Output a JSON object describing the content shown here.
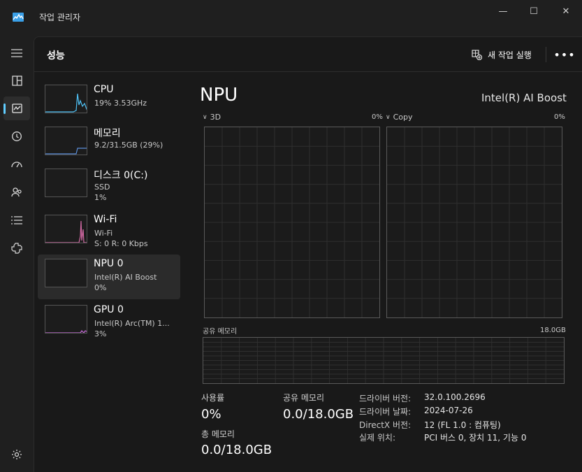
{
  "window": {
    "title": "작업 관리자",
    "controls": {
      "minimize": "—",
      "maximize": "☐",
      "close": "✕"
    }
  },
  "nav": {
    "items": [
      {
        "name": "hamburger-icon"
      },
      {
        "name": "processes-icon"
      },
      {
        "name": "performance-icon",
        "active": true
      },
      {
        "name": "app-history-icon"
      },
      {
        "name": "startup-apps-icon"
      },
      {
        "name": "users-icon"
      },
      {
        "name": "details-icon"
      },
      {
        "name": "services-icon"
      },
      {
        "name": "settings-icon"
      }
    ]
  },
  "header": {
    "title": "성능",
    "run_task": "새 작업 실행",
    "more": "•••"
  },
  "devices": [
    {
      "name": "CPU",
      "sub1": "19% 3.53GHz",
      "sub2": "",
      "color": "#4fc3f7"
    },
    {
      "name": "메모리",
      "sub1": "9.2/31.5GB (29%)",
      "sub2": "",
      "color": "#5b8fdc"
    },
    {
      "name": "디스크 0(C:)",
      "sub1": "SSD",
      "sub2": "1%",
      "color": "#7cb342"
    },
    {
      "name": "Wi-Fi",
      "sub1": "Wi-Fi",
      "sub2": "S: 0 R: 0 Kbps",
      "color": "#d46aa5"
    },
    {
      "name": "NPU 0",
      "sub1": "Intel(R) AI Boost",
      "sub2": "0%",
      "color": "#4fc3f7",
      "selected": true
    },
    {
      "name": "GPU 0",
      "sub1": "Intel(R) Arc(TM) 1...",
      "sub2": "3%",
      "color": "#c36ad4"
    }
  ],
  "detail": {
    "title": "NPU",
    "device_name": "Intel(R) AI Boost",
    "engines": [
      {
        "label": "3D",
        "pct": "0%"
      },
      {
        "label": "Copy",
        "pct": "0%"
      }
    ],
    "shared_memory_label": "공유 메모리",
    "shared_memory_max": "18.0GB",
    "stats": {
      "utilization_label": "사용률",
      "utilization_value": "0%",
      "shared_label": "공유 메모리",
      "shared_value": "0.0/18.0GB",
      "total_label": "총 메모리",
      "total_value": "0.0/18.0GB"
    },
    "info": [
      {
        "key": "드라이버 버전:",
        "value": "32.0.100.2696"
      },
      {
        "key": "드라이버 날짜:",
        "value": "2024-07-26"
      },
      {
        "key": "DirectX 버전:",
        "value": "12 (FL 1.0 : 컴퓨팅)"
      },
      {
        "key": "실제 위치:",
        "value": "PCI 버스 0, 장치 11, 기능 0"
      }
    ]
  }
}
